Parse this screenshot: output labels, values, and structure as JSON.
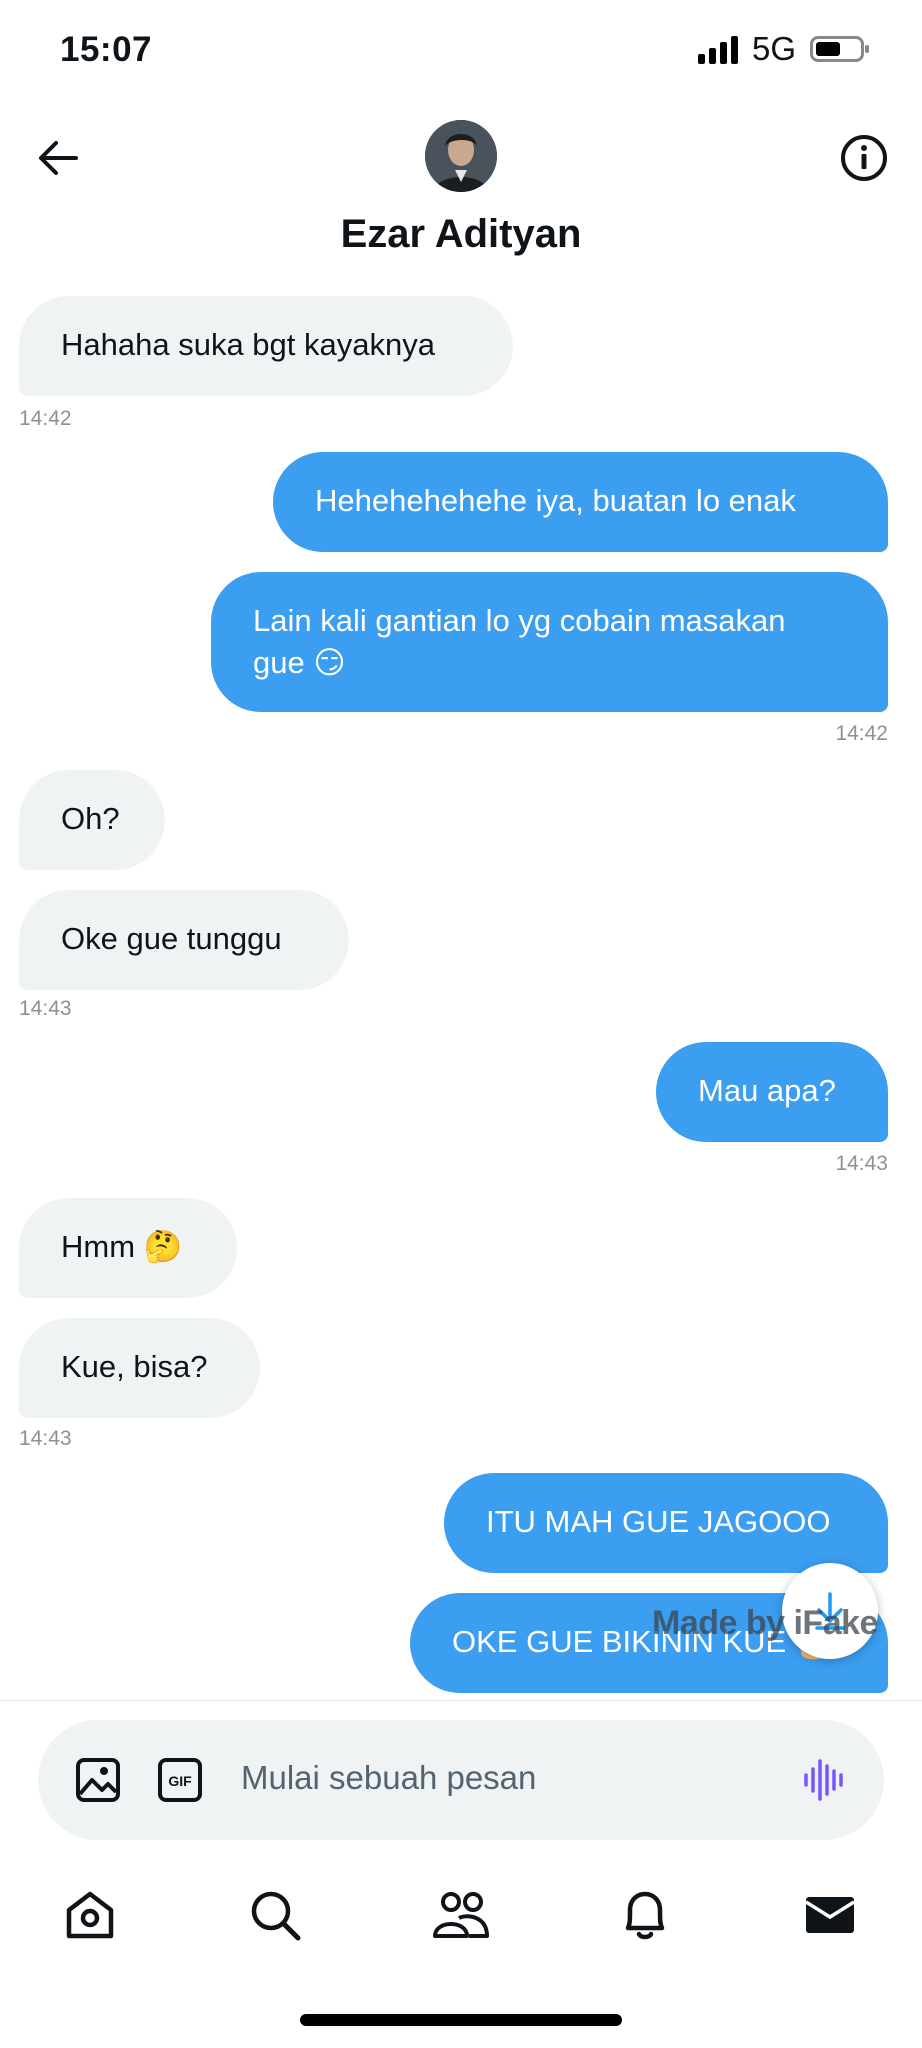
{
  "status": {
    "time": "15:07",
    "network": "5G"
  },
  "header": {
    "name": "Ezar Adityan"
  },
  "messages": [
    {
      "text": "Hahaha suka bgt kayaknya"
    },
    {
      "text": "Hehehehehehe iya, buatan lo enak"
    },
    {
      "line1": "Lain kali gantian lo yg cobain masakan",
      "line2": "gue 😏"
    },
    {
      "text": "Oh?"
    },
    {
      "text": "Oke gue tunggu"
    },
    {
      "text": "Mau apa?"
    },
    {
      "text": "Hmm 🤔"
    },
    {
      "text": "Kue, bisa?"
    },
    {
      "text": "ITU MAH GUE JAGOOO"
    },
    {
      "text": "OKE GUE BIKININ KUE 🎂"
    }
  ],
  "timestamps": [
    "14:42",
    "14:42",
    "14:43",
    "14:43",
    "14:43"
  ],
  "watermark": "Made by iFake",
  "composer": {
    "placeholder": "Mulai sebuah pesan",
    "image_icon": "image-icon",
    "gif_label": "GIF",
    "voice_icon": "voice-wave-icon"
  },
  "tabs": [
    "home-icon",
    "search-icon",
    "communities-icon",
    "notifications-icon",
    "messages-icon"
  ],
  "colors": {
    "outgoing": "#3b9ef0",
    "incoming": "#eff3f4",
    "accent_voice": "#7856ff"
  }
}
